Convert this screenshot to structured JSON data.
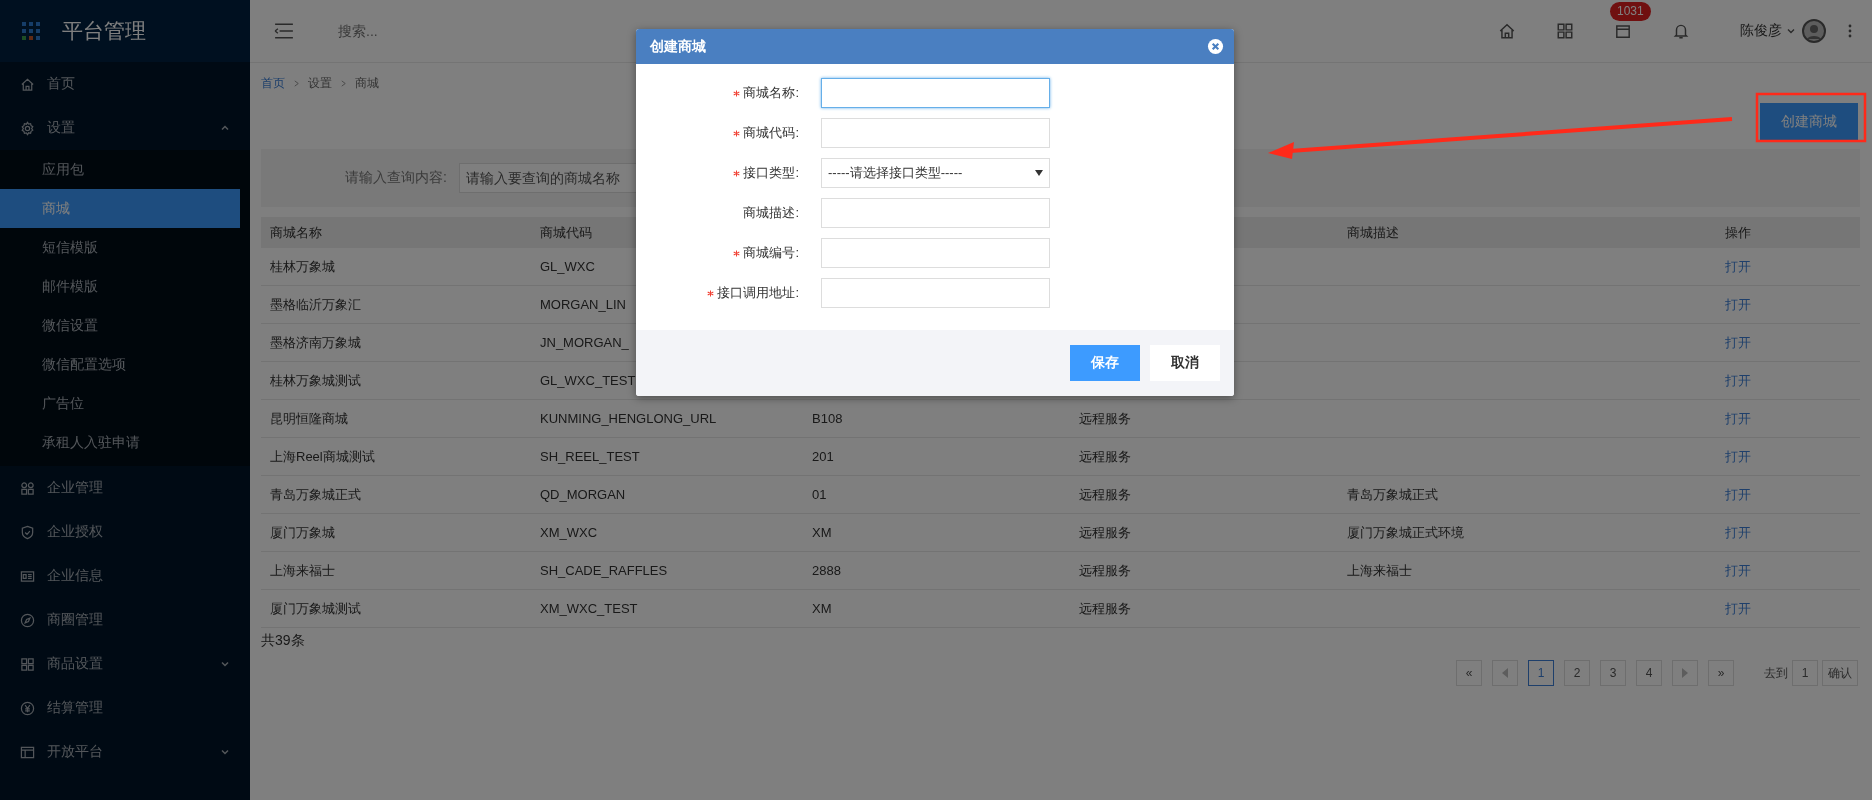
{
  "sidebar": {
    "title": "平台管理",
    "items": [
      {
        "label": "首页",
        "selected": false
      },
      {
        "label": "设置",
        "selected": false,
        "expanded": true,
        "children": [
          {
            "label": "应用包",
            "selected": false
          },
          {
            "label": "商城",
            "selected": true
          },
          {
            "label": "短信模版",
            "selected": false
          },
          {
            "label": "邮件模版",
            "selected": false
          },
          {
            "label": "微信设置",
            "selected": false
          },
          {
            "label": "微信配置选项",
            "selected": false
          },
          {
            "label": "广告位",
            "selected": false
          },
          {
            "label": "承租人入驻申请",
            "selected": false
          }
        ]
      },
      {
        "label": "企业管理",
        "selected": false
      },
      {
        "label": "企业授权",
        "selected": false
      },
      {
        "label": "企业信息",
        "selected": false
      },
      {
        "label": "商圈管理",
        "selected": false
      },
      {
        "label": "商品设置",
        "selected": false,
        "expanded": false
      },
      {
        "label": "结算管理",
        "selected": false
      },
      {
        "label": "开放平台",
        "selected": false,
        "expanded": false
      }
    ]
  },
  "topbar": {
    "search": {
      "placeholder": "搜索..."
    },
    "badge": "1031",
    "user": "陈俊彦"
  },
  "breadcrumb": [
    "首页",
    "设置",
    "商城"
  ],
  "create_button": "创建商城",
  "query": {
    "label": "请输入查询内容:",
    "placeholder": "请输入要查询的商城名称"
  },
  "table": {
    "columns": {
      "name": "商城名称",
      "code": "商城代码",
      "description": "商城描述",
      "action": "操作"
    },
    "rows": [
      {
        "name": "桂林万象城",
        "code": "GL_WXC",
        "action": "打开"
      },
      {
        "name": "墨格临沂万象汇",
        "code": "MORGAN_LIN",
        "action": "打开"
      },
      {
        "name": "墨格济南万象城",
        "code": "JN_MORGAN_",
        "action": "打开"
      },
      {
        "name": "桂林万象城测试",
        "code": "GL_WXC_TEST",
        "action": "打开"
      },
      {
        "name": "昆明恒隆商城",
        "code": "KUNMING_HENGLONG_URL",
        "column_3": "B108",
        "column_4": "远程服务",
        "action": "打开"
      },
      {
        "name": "上海Reel商城测试",
        "code": "SH_REEL_TEST",
        "column_3": "201",
        "column_4": "远程服务",
        "action": "打开"
      },
      {
        "name": "青岛万象城正式",
        "code": "QD_MORGAN",
        "column_3": "01",
        "column_4": "远程服务",
        "description": "青岛万象城正式",
        "action": "打开"
      },
      {
        "name": "厦门万象城",
        "code": "XM_WXC",
        "column_3": "XM",
        "column_4": "远程服务",
        "description": "厦门万象城正式环境",
        "action": "打开"
      },
      {
        "name": "上海来福士",
        "code": "SH_CADE_RAFFLES",
        "column_3": "2888",
        "column_4": "远程服务",
        "description": "上海来福士",
        "action": "打开"
      },
      {
        "name": "厦门万象城测试",
        "code": "XM_WXC_TEST",
        "column_3": "XM",
        "column_4": "远程服务",
        "action": "打开"
      }
    ]
  },
  "total": "共39条",
  "pagination": {
    "first": "«",
    "pages": [
      {
        "label": "1",
        "selected": true
      },
      {
        "label": "2",
        "selected": false
      },
      {
        "label": "3",
        "selected": false
      },
      {
        "label": "4",
        "selected": false
      }
    ],
    "last": "»",
    "goto_label": "去到",
    "goto_value": "1",
    "confirm": "确认"
  },
  "dialog": {
    "title": "创建商城",
    "fields": [
      {
        "label": "商城名称:",
        "required": true,
        "kind": "input",
        "focused": true
      },
      {
        "label": "商城代码:",
        "required": true,
        "kind": "input",
        "focused": false
      },
      {
        "label": "接口类型:",
        "required": true,
        "kind": "select",
        "value": "-----请选择接口类型-----",
        "focused": false
      },
      {
        "label": "商城描述:",
        "required": false,
        "kind": "input",
        "focused": false
      },
      {
        "label": "商城编号:",
        "required": true,
        "kind": "input",
        "focused": false
      },
      {
        "label": "接口调用地址:",
        "required": true,
        "kind": "input",
        "focused": false
      }
    ],
    "buttons": [
      {
        "label": "保存",
        "kind": "primary"
      },
      {
        "label": "取消",
        "kind": "secondary"
      }
    ]
  }
}
